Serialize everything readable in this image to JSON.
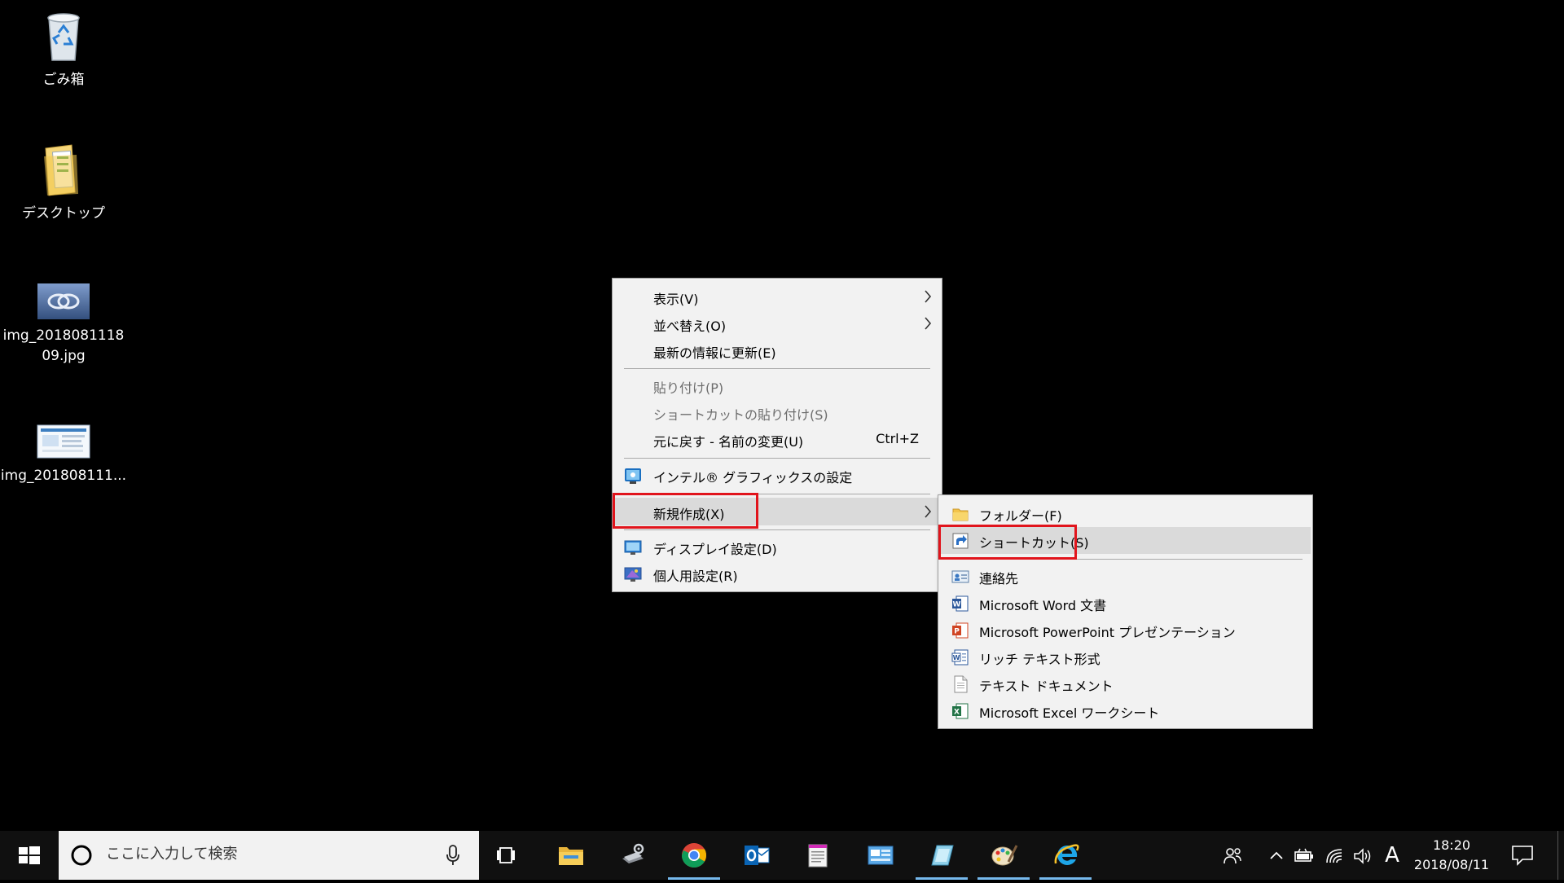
{
  "desktop": {
    "icons": [
      {
        "label": "ごみ箱",
        "icon": "recycle-bin-icon"
      },
      {
        "label": "デスクトップ",
        "icon": "folder-icon"
      },
      {
        "label": "img_201808111809.jpg",
        "icon": "image-file-icon"
      },
      {
        "label": "img_201808111...",
        "icon": "image-file-icon"
      }
    ]
  },
  "context_menu": {
    "items": [
      {
        "label": "表示(V)",
        "has_submenu": true
      },
      {
        "label": "並べ替え(O)",
        "has_submenu": true
      },
      {
        "label": "最新の情報に更新(E)"
      },
      {
        "label": "貼り付け(P)",
        "disabled": true
      },
      {
        "label": "ショートカットの貼り付け(S)",
        "disabled": true
      },
      {
        "label": "元に戻す - 名前の変更(U)",
        "shortcut": "Ctrl+Z"
      },
      {
        "label": "インテル® グラフィックスの設定",
        "icon": "intel-graphics-icon"
      },
      {
        "label": "新規作成(X)",
        "has_submenu": true,
        "highlighted": true
      },
      {
        "label": "ディスプレイ設定(D)",
        "icon": "display-settings-icon"
      },
      {
        "label": "個人用設定(R)",
        "icon": "personalize-icon"
      }
    ]
  },
  "new_submenu": {
    "items": [
      {
        "label": "フォルダー(F)",
        "icon": "folder-icon"
      },
      {
        "label": "ショートカット(S)",
        "icon": "shortcut-icon",
        "highlighted": true
      },
      {
        "label": "連絡先",
        "icon": "contact-icon"
      },
      {
        "label": "Microsoft Word 文書",
        "icon": "word-icon"
      },
      {
        "label": "Microsoft PowerPoint プレゼンテーション",
        "icon": "powerpoint-icon"
      },
      {
        "label": "リッチ テキスト形式",
        "icon": "rich-text-icon"
      },
      {
        "label": "テキスト ドキュメント",
        "icon": "text-document-icon"
      },
      {
        "label": "Microsoft Excel ワークシート",
        "icon": "excel-icon"
      }
    ]
  },
  "taskbar": {
    "search_placeholder": "ここに入力して検索",
    "apps": [
      {
        "name": "task-view-icon"
      },
      {
        "name": "file-explorer-icon"
      },
      {
        "name": "settings-tool-icon"
      },
      {
        "name": "chrome-icon",
        "active": true
      },
      {
        "name": "outlook-icon"
      },
      {
        "name": "notepad-icon"
      },
      {
        "name": "control-panel-icon"
      },
      {
        "name": "snipping-tool-icon",
        "active": true
      },
      {
        "name": "paint-icon",
        "active": true
      },
      {
        "name": "internet-explorer-icon",
        "active": true
      }
    ],
    "ime_indicator": "A",
    "clock": {
      "time": "18:20",
      "date": "2018/08/11"
    }
  },
  "colors": {
    "highlight_box": "#e1141c",
    "menu_bg": "#f2f2f2",
    "menu_hover": "#dadada",
    "taskbar_bg": "#101010",
    "active_indicator": "#76b9ed"
  }
}
